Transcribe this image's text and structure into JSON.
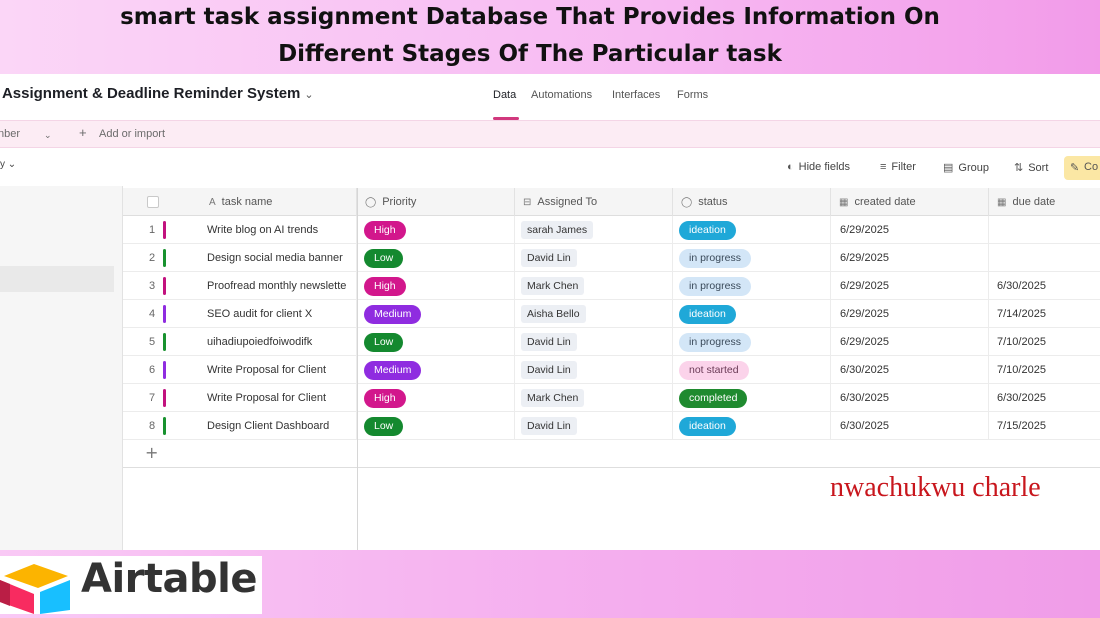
{
  "caption": {
    "line1": "smart task assignment Database That Provides Information On",
    "line2": "Different Stages Of The Particular task"
  },
  "app": {
    "base_title": "k Assignment & Deadline Reminder System",
    "nav_tabs": [
      "Data",
      "Automations",
      "Interfaces",
      "Forms"
    ],
    "active_tab": "Data",
    "table_tab": "nber",
    "add_or_import": "Add or import",
    "toolbar": {
      "hide_fields": "Hide fields",
      "filter": "Filter",
      "group": "Group",
      "sort": "Sort",
      "color": "Co"
    },
    "columns": {
      "task_name": "task name",
      "priority": "Priority",
      "assigned_to": "Assigned To",
      "status": "status",
      "created_date": "created date",
      "due_date": "due date"
    },
    "rows": [
      {
        "num": "1",
        "task": "Write blog on AI trends",
        "priority": "High",
        "assignee": "sarah James",
        "status": "ideation",
        "created": "6/29/2025",
        "due": ""
      },
      {
        "num": "2",
        "task": "Design social media banner",
        "priority": "Low",
        "assignee": "David Lin",
        "status": "in progress",
        "created": "6/29/2025",
        "due": ""
      },
      {
        "num": "3",
        "task": "Proofread monthly newslette",
        "priority": "High",
        "assignee": "Mark Chen",
        "status": "in progress",
        "created": "6/29/2025",
        "due": "6/30/2025"
      },
      {
        "num": "4",
        "task": "SEO audit for client X",
        "priority": "Medium",
        "assignee": "Aisha Bello",
        "status": "ideation",
        "created": "6/29/2025",
        "due": "7/14/2025"
      },
      {
        "num": "5",
        "task": "uihadiupoiedfoiwodifk",
        "priority": "Low",
        "assignee": "David Lin",
        "status": "in progress",
        "created": "6/29/2025",
        "due": "7/10/2025"
      },
      {
        "num": "6",
        "task": "Write Proposal for Client",
        "priority": "Medium",
        "assignee": "David Lin",
        "status": "not started",
        "created": "6/30/2025",
        "due": "7/10/2025"
      },
      {
        "num": "7",
        "task": "Write Proposal for Client",
        "priority": "High",
        "assignee": "Mark Chen",
        "status": "completed",
        "created": "6/30/2025",
        "due": "6/30/2025"
      },
      {
        "num": "8",
        "task": "Design Client Dashboard",
        "priority": "Low",
        "assignee": "David Lin",
        "status": "ideation",
        "created": "6/30/2025",
        "due": "7/15/2025"
      }
    ],
    "add_row_symbol": "+"
  },
  "priority_colors": {
    "High": {
      "bg": "#d2178c",
      "fg": "#ffffff"
    },
    "Medium": {
      "bg": "#8f2ce0",
      "fg": "#ffffff"
    },
    "Low": {
      "bg": "#14892f",
      "fg": "#ffffff"
    }
  },
  "status_colors": {
    "ideation": {
      "bg": "#1fa8d8",
      "fg": "#ffffff"
    },
    "in progress": {
      "bg": "#d3e6f7",
      "fg": "#3a4a5a"
    },
    "not started": {
      "bg": "#fbd3ea",
      "fg": "#6a3a56"
    },
    "completed": {
      "bg": "#1f8a2f",
      "fg": "#ffffff"
    }
  },
  "row_bar_colors": [
    "#c2127e",
    "#18922f",
    "#c2127e",
    "#8f2ce0",
    "#18922f",
    "#8f2ce0",
    "#c2127e",
    "#18922f"
  ],
  "signature": "nwachukwu charle",
  "logo": {
    "wordmark": "Airtable"
  }
}
